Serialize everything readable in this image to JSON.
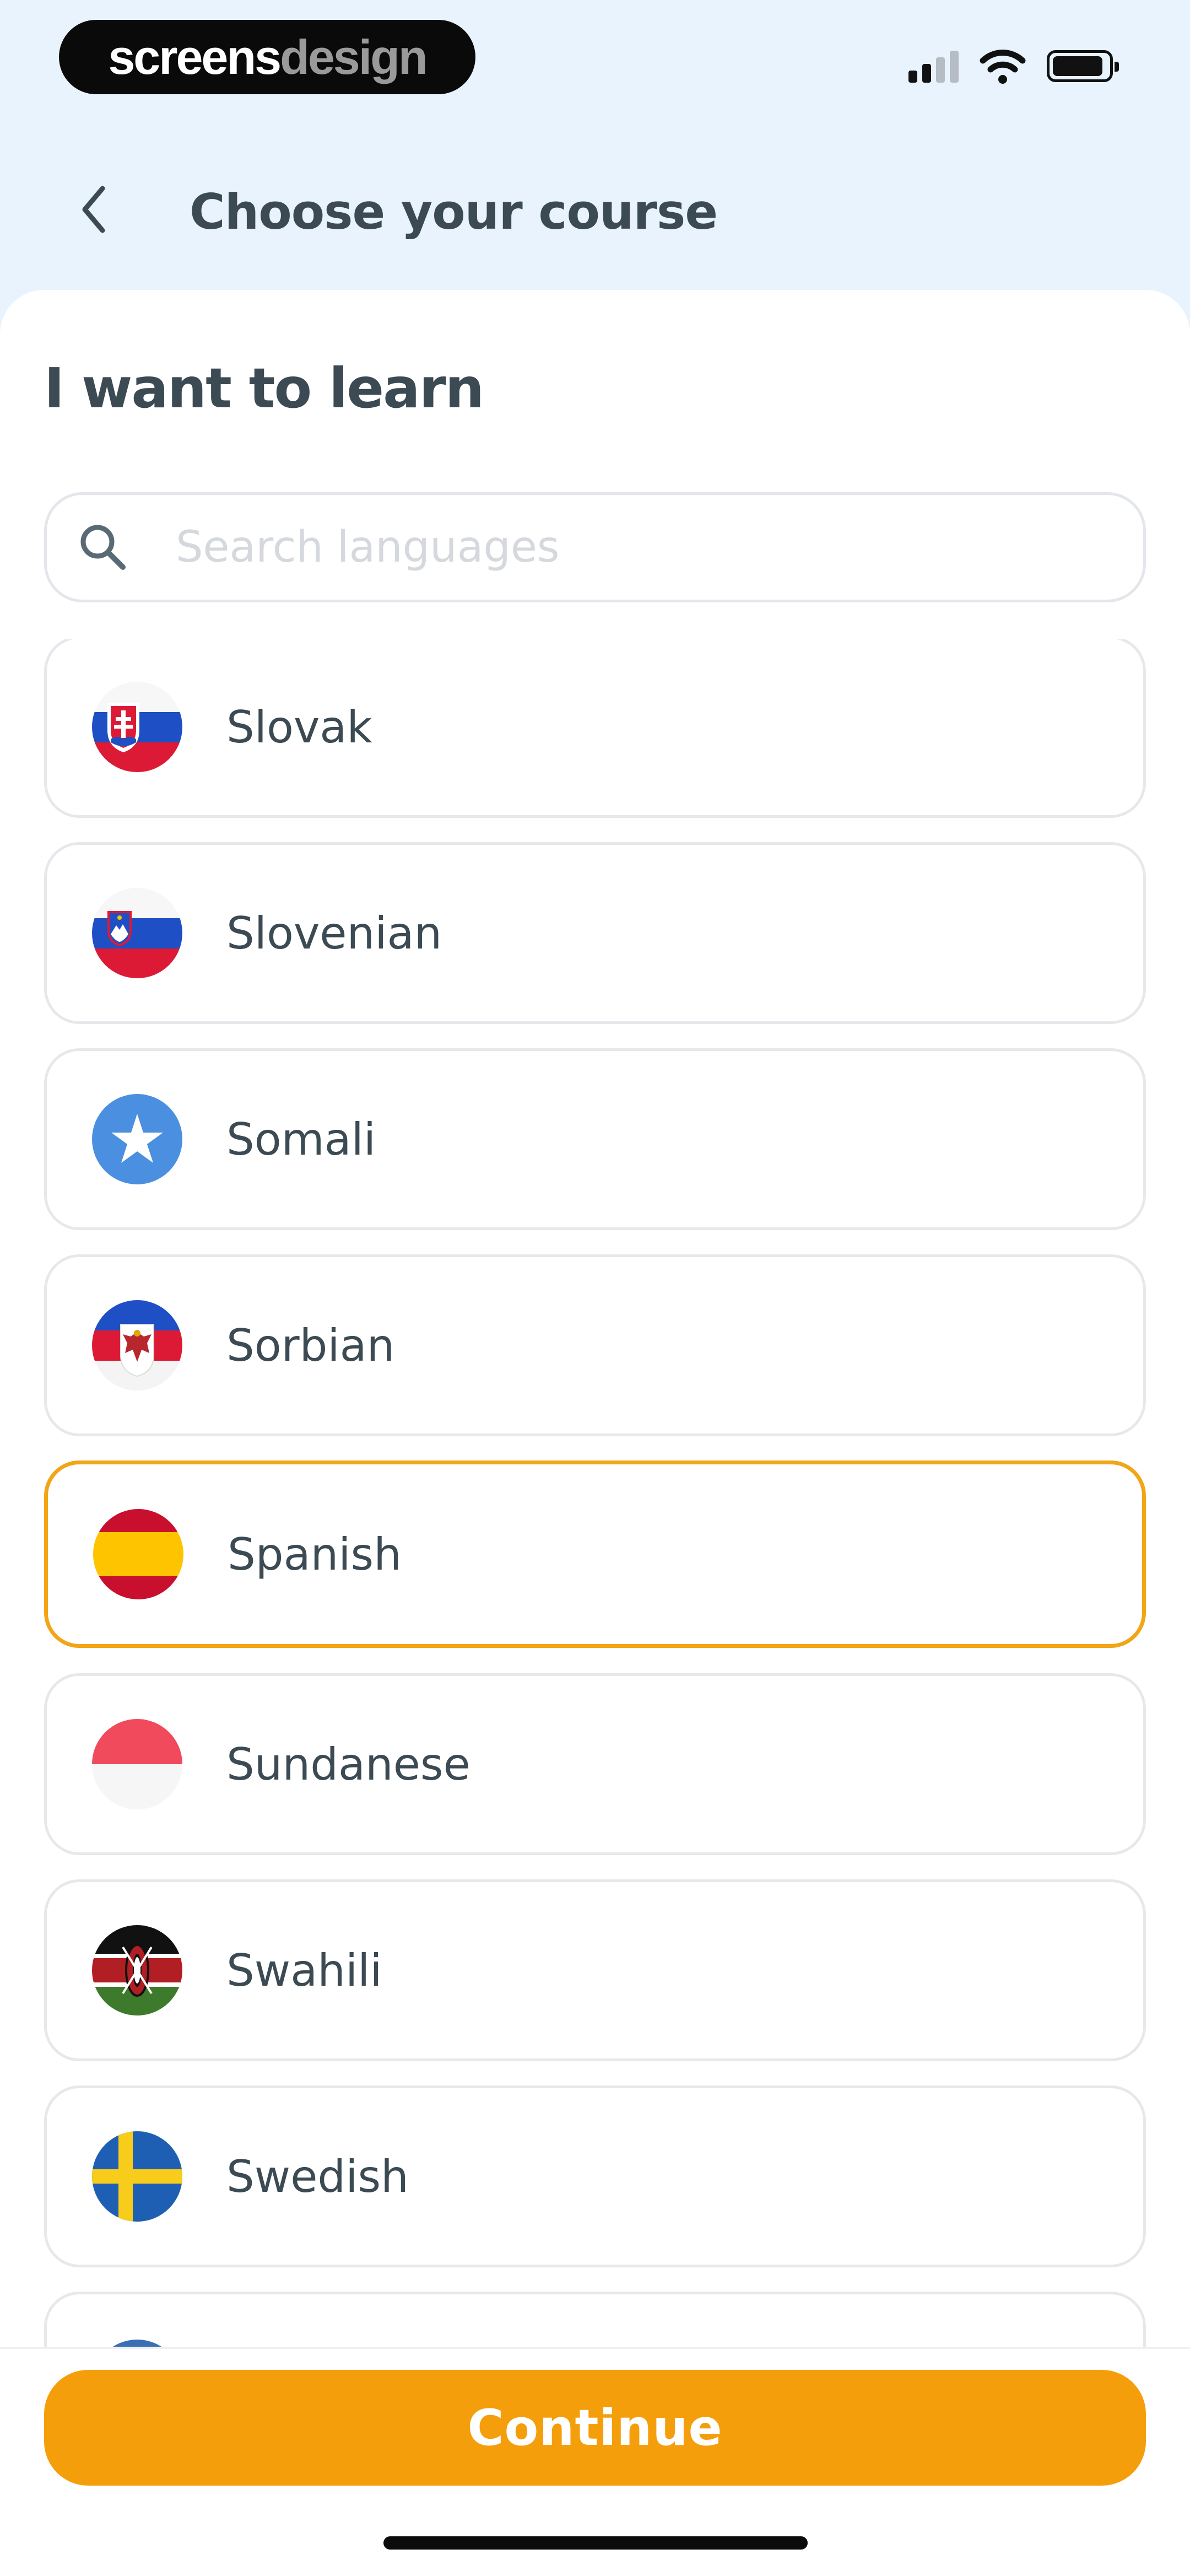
{
  "status_bar": {
    "brand_part1": "screens",
    "brand_part2": "design",
    "icons": [
      "signal-icon",
      "wifi-icon",
      "battery-icon"
    ]
  },
  "header": {
    "back_icon": "chevron-left-icon",
    "title": "Choose your course"
  },
  "main": {
    "section_title": "I want to learn",
    "search": {
      "placeholder": "Search languages",
      "value": "",
      "icon": "search-icon"
    },
    "languages": [
      {
        "label": "Slovak",
        "flag": "slovakia-flag-icon",
        "selected": false
      },
      {
        "label": "Slovenian",
        "flag": "slovenia-flag-icon",
        "selected": false
      },
      {
        "label": "Somali",
        "flag": "somalia-flag-icon",
        "selected": false
      },
      {
        "label": "Sorbian",
        "flag": "sorbian-flag-icon",
        "selected": false
      },
      {
        "label": "Spanish",
        "flag": "spain-flag-icon",
        "selected": true
      },
      {
        "label": "Sundanese",
        "flag": "sundanese-flag-icon",
        "selected": false
      },
      {
        "label": "Swahili",
        "flag": "kenya-flag-icon",
        "selected": false
      },
      {
        "label": "Swedish",
        "flag": "sweden-flag-icon",
        "selected": false
      }
    ]
  },
  "footer": {
    "continue_label": "Continue"
  },
  "colors": {
    "accent": "#f59e0b",
    "selected_border": "#f2a516",
    "header_bg": "#e8f3fd",
    "text": "#3b4a53"
  }
}
